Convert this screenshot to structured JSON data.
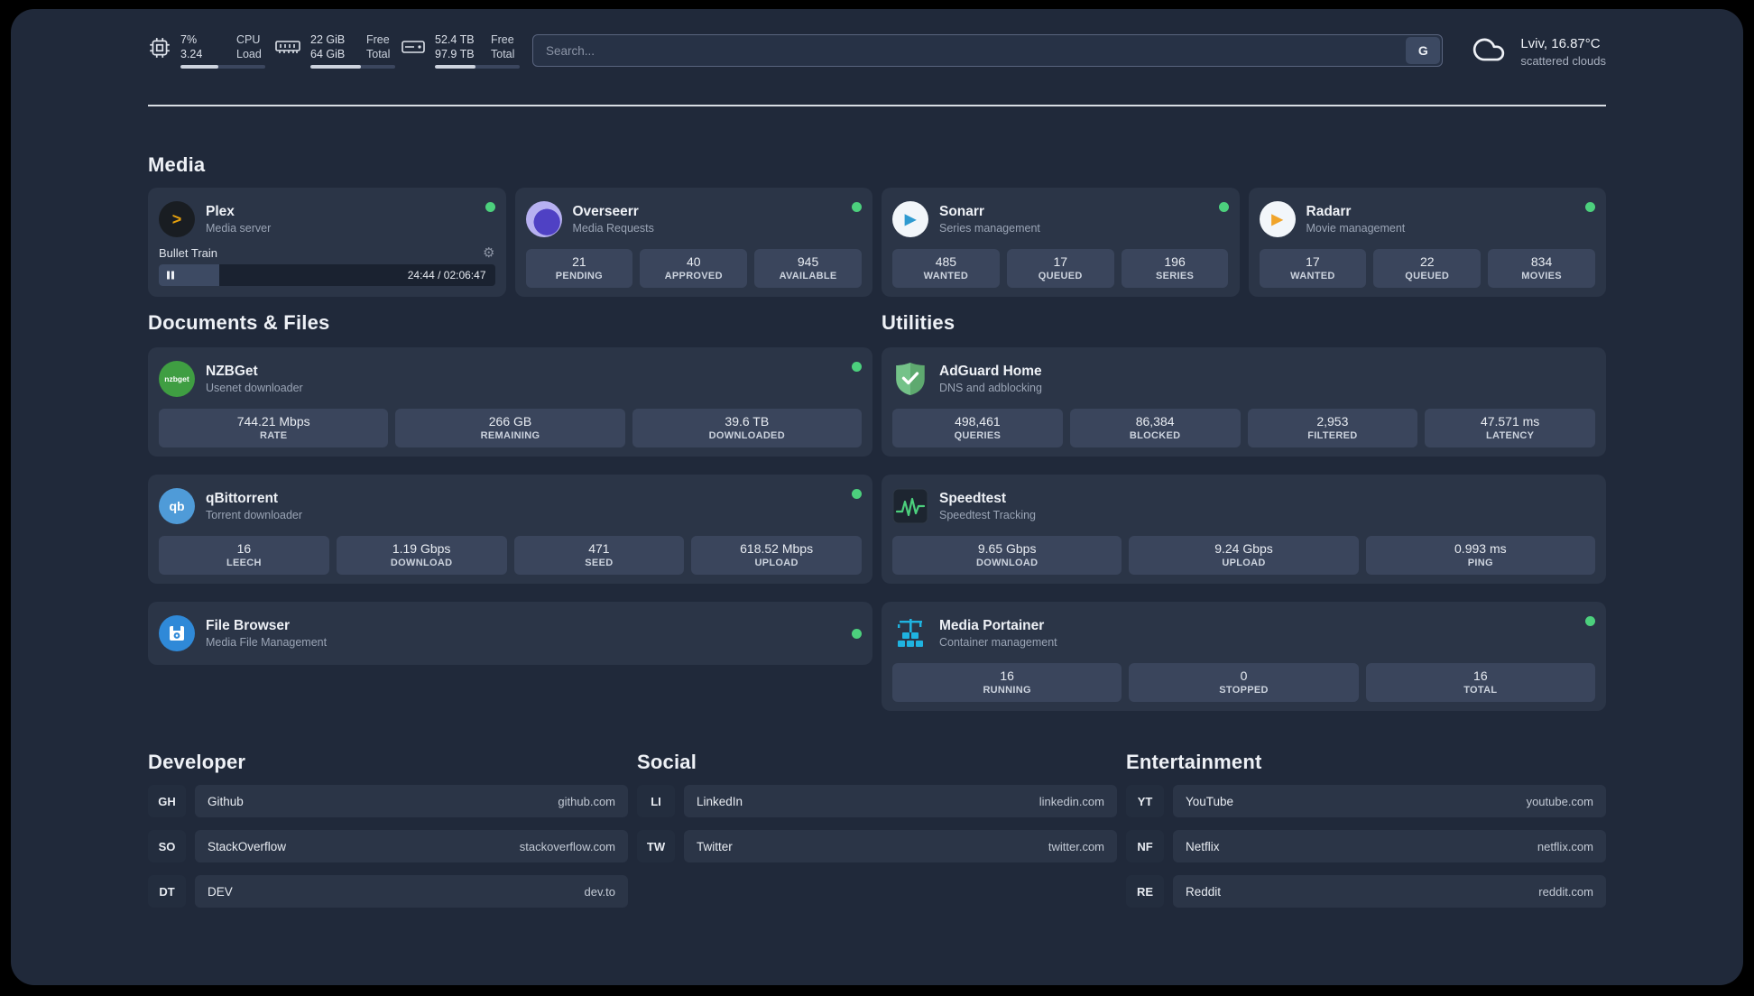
{
  "topbar": {
    "cpu": {
      "value_left": "7%",
      "value_right": "3.24",
      "label_top": "CPU",
      "label_bottom": "Load",
      "progress_percent": 45
    },
    "ram": {
      "value_left": "22 GiB",
      "value_right": "64 GiB",
      "label_top": "Free",
      "label_bottom": "Total",
      "progress_percent": 60
    },
    "disk": {
      "value_left": "52.4 TB",
      "value_right": "97.9 TB",
      "label_top": "Free",
      "label_bottom": "Total",
      "progress_percent": 48
    },
    "search": {
      "placeholder": "Search...",
      "button_label": "G"
    },
    "weather": {
      "location": "Lviv, 16.87°C",
      "condition": "scattered clouds"
    }
  },
  "media": {
    "heading": "Media",
    "plex": {
      "title": "Plex",
      "subtitle": "Media server",
      "online": true,
      "now_playing": {
        "track": "Bullet Train",
        "time": "24:44 / 02:06:47",
        "progress_percent": 18
      }
    },
    "overseerr": {
      "title": "Overseerr",
      "subtitle": "Media Requests",
      "online": true,
      "stats": [
        {
          "value": "21",
          "label": "PENDING"
        },
        {
          "value": "40",
          "label": "APPROVED"
        },
        {
          "value": "945",
          "label": "AVAILABLE"
        }
      ]
    },
    "sonarr": {
      "title": "Sonarr",
      "subtitle": "Series management",
      "online": true,
      "stats": [
        {
          "value": "485",
          "label": "WANTED"
        },
        {
          "value": "17",
          "label": "QUEUED"
        },
        {
          "value": "196",
          "label": "SERIES"
        }
      ]
    },
    "radarr": {
      "title": "Radarr",
      "subtitle": "Movie management",
      "online": true,
      "stats": [
        {
          "value": "17",
          "label": "WANTED"
        },
        {
          "value": "22",
          "label": "QUEUED"
        },
        {
          "value": "834",
          "label": "MOVIES"
        }
      ]
    }
  },
  "documents": {
    "heading": "Documents & Files",
    "nzbget": {
      "title": "NZBGet",
      "subtitle": "Usenet downloader",
      "online": true,
      "icon_text": "nzbget",
      "stats": [
        {
          "value": "744.21 Mbps",
          "label": "RATE"
        },
        {
          "value": "266 GB",
          "label": "REMAINING"
        },
        {
          "value": "39.6 TB",
          "label": "DOWNLOADED"
        }
      ]
    },
    "qbittorrent": {
      "title": "qBittorrent",
      "subtitle": "Torrent downloader",
      "online": true,
      "icon_text": "qb",
      "stats": [
        {
          "value": "16",
          "label": "LEECH"
        },
        {
          "value": "1.19 Gbps",
          "label": "DOWNLOAD"
        },
        {
          "value": "471",
          "label": "SEED"
        },
        {
          "value": "618.52 Mbps",
          "label": "UPLOAD"
        }
      ]
    },
    "filebrowser": {
      "title": "File Browser",
      "subtitle": "Media File Management",
      "online": true
    }
  },
  "utilities": {
    "heading": "Utilities",
    "adguard": {
      "title": "AdGuard Home",
      "subtitle": "DNS and adblocking",
      "stats": [
        {
          "value": "498,461",
          "label": "QUERIES"
        },
        {
          "value": "86,384",
          "label": "BLOCKED"
        },
        {
          "value": "2,953",
          "label": "FILTERED"
        },
        {
          "value": "47.571 ms",
          "label": "LATENCY"
        }
      ]
    },
    "speedtest": {
      "title": "Speedtest",
      "subtitle": "Speedtest Tracking",
      "stats": [
        {
          "value": "9.65 Gbps",
          "label": "DOWNLOAD"
        },
        {
          "value": "9.24 Gbps",
          "label": "UPLOAD"
        },
        {
          "value": "0.993 ms",
          "label": "PING"
        }
      ]
    },
    "portainer": {
      "title": "Media Portainer",
      "subtitle": "Container management",
      "online": true,
      "stats": [
        {
          "value": "16",
          "label": "RUNNING"
        },
        {
          "value": "0",
          "label": "STOPPED"
        },
        {
          "value": "16",
          "label": "TOTAL"
        }
      ]
    }
  },
  "bookmarks": {
    "developer": {
      "heading": "Developer",
      "items": [
        {
          "abbr": "GH",
          "name": "Github",
          "url": "github.com"
        },
        {
          "abbr": "SO",
          "name": "StackOverflow",
          "url": "stackoverflow.com"
        },
        {
          "abbr": "DT",
          "name": "DEV",
          "url": "dev.to"
        }
      ]
    },
    "social": {
      "heading": "Social",
      "items": [
        {
          "abbr": "LI",
          "name": "LinkedIn",
          "url": "linkedin.com"
        },
        {
          "abbr": "TW",
          "name": "Twitter",
          "url": "twitter.com"
        }
      ]
    },
    "entertainment": {
      "heading": "Entertainment",
      "items": [
        {
          "abbr": "YT",
          "name": "YouTube",
          "url": "youtube.com"
        },
        {
          "abbr": "NF",
          "name": "Netflix",
          "url": "netflix.com"
        },
        {
          "abbr": "RE",
          "name": "Reddit",
          "url": "reddit.com"
        }
      ]
    }
  },
  "colors": {
    "background": "#20293a",
    "card": "#2b3547",
    "tile": "#3a455c",
    "status_online": "#4cd07d",
    "accent_green": "#4cd07d"
  }
}
